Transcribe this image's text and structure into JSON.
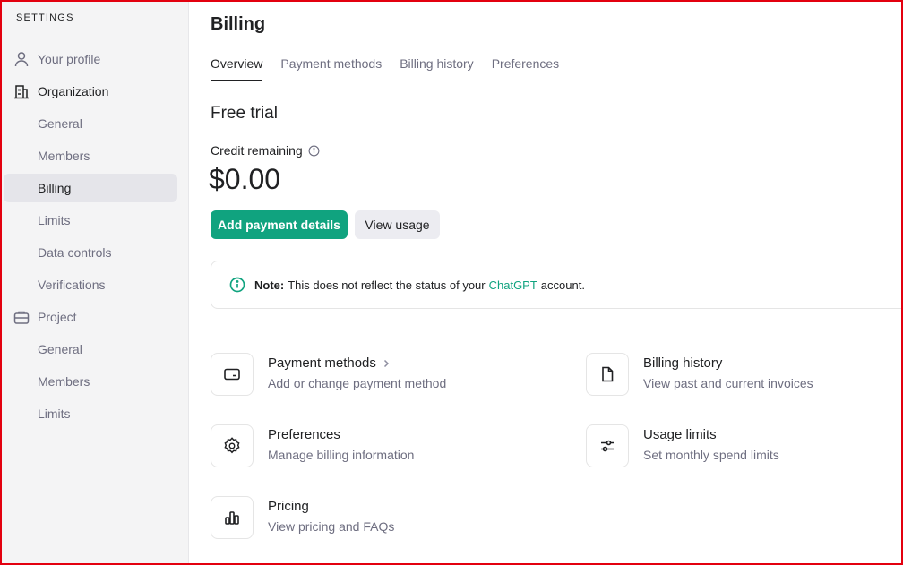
{
  "sidebar": {
    "heading": "SETTINGS",
    "items": [
      {
        "label": "Your profile",
        "icon": "person-icon"
      },
      {
        "label": "Organization",
        "icon": "building-icon"
      },
      {
        "label": "General"
      },
      {
        "label": "Members"
      },
      {
        "label": "Billing",
        "active": true
      },
      {
        "label": "Limits"
      },
      {
        "label": "Data controls"
      },
      {
        "label": "Verifications"
      },
      {
        "label": "Project",
        "icon": "briefcase-icon"
      },
      {
        "label": "General"
      },
      {
        "label": "Members"
      },
      {
        "label": "Limits"
      }
    ]
  },
  "page": {
    "title": "Billing",
    "tabs": [
      "Overview",
      "Payment methods",
      "Billing history",
      "Preferences"
    ],
    "active_tab": "Overview"
  },
  "trial": {
    "title": "Free trial",
    "credit_label": "Credit remaining",
    "amount": "$0.00",
    "primary_button": "Add payment details",
    "secondary_button": "View usage"
  },
  "note": {
    "prefix": "Note:",
    "text": "This does not reflect the status of your",
    "link": "ChatGPT",
    "suffix": "account."
  },
  "cards": [
    {
      "title": "Payment methods",
      "desc": "Add or change payment method",
      "icon": "credit-card-icon"
    },
    {
      "title": "Billing history",
      "desc": "View past and current invoices",
      "icon": "document-icon"
    },
    {
      "title": "Preferences",
      "desc": "Manage billing information",
      "icon": "gear-icon"
    },
    {
      "title": "Usage limits",
      "desc": "Set monthly spend limits",
      "icon": "sliders-icon"
    },
    {
      "title": "Pricing",
      "desc": "View pricing and FAQs",
      "icon": "bar-chart-icon"
    }
  ],
  "colors": {
    "accent": "#10a37f",
    "sidebar_bg": "#f4f4f5",
    "active_bg": "#e5e5ea",
    "frame": "#e3000f"
  }
}
